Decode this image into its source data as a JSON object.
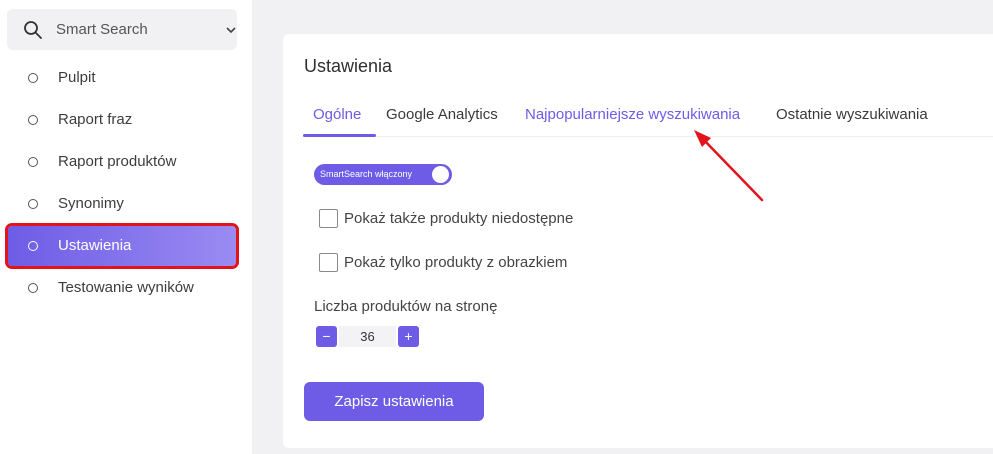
{
  "sidebar": {
    "search": {
      "label": "Smart Search",
      "icon": "search-icon"
    },
    "items": [
      {
        "label": "Pulpit",
        "active": false
      },
      {
        "label": "Raport fraz",
        "active": false
      },
      {
        "label": "Raport produktów",
        "active": false
      },
      {
        "label": "Synonimy",
        "active": false
      },
      {
        "label": "Ustawienia",
        "active": true
      },
      {
        "label": "Testowanie wyników",
        "active": false
      }
    ]
  },
  "main": {
    "title": "Ustawienia",
    "tabs": [
      {
        "label": "Ogólne",
        "selected": true
      },
      {
        "label": "Google Analytics",
        "selected": false
      },
      {
        "label": "Najpopularniejsze wyszukiwania",
        "selected": false
      },
      {
        "label": "Ostatnie wyszukiwania",
        "selected": false
      }
    ],
    "toggle": {
      "label": "SmartSearch włączony",
      "on": true
    },
    "checkboxes": [
      {
        "label": "Pokaż także produkty niedostępne",
        "checked": false
      },
      {
        "label": "Pokaż tylko produkty z obrazkiem",
        "checked": false
      }
    ],
    "products_per_page": {
      "label": "Liczba produktów na stronę",
      "value": "36",
      "minus": "−",
      "plus": "+"
    },
    "save_button": "Zapisz ustawienia"
  },
  "colors": {
    "accent": "#6e5ce6",
    "highlight": "#e2131c"
  }
}
